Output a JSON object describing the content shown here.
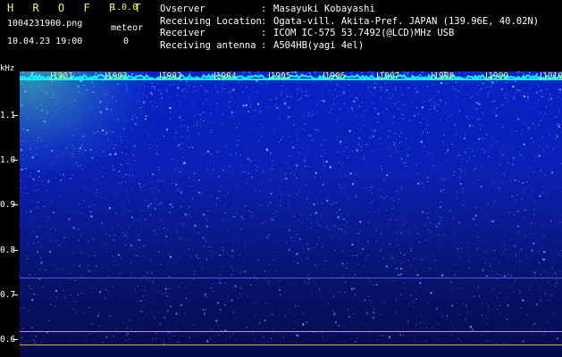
{
  "app": {
    "name": "H R O F F T",
    "version": "1.0.0"
  },
  "file": {
    "name": "1004231900.png",
    "datetime": "10.04.23 19:00"
  },
  "meteor": {
    "label": "meteor",
    "count": "0"
  },
  "info": [
    {
      "key": "Ovserver",
      "sep": ":",
      "value": "Masayuki Kobayashi"
    },
    {
      "key": "Receiving Location",
      "sep": ":",
      "value": "Ogata-vill. Akita-Pref. JAPAN (139.96E, 40.02N)"
    },
    {
      "key": "Receiver",
      "sep": ":",
      "value": "ICOM IC-575 53.7492(@LCD)MHz USB"
    },
    {
      "key": "Receiving antenna",
      "sep": ":",
      "value": "A504HB(yagi 4el)"
    }
  ],
  "chart_data": {
    "type": "heatmap",
    "y_unit": "kHz",
    "y_ticks": [
      "1.1",
      "1.0",
      "0.9",
      "0.8",
      "0.7",
      "0.6"
    ],
    "x_ticks": [
      "1901",
      "1902",
      "1903",
      "1904",
      "1905",
      "1906",
      "1907",
      "1908",
      "1909",
      "1910"
    ],
    "colors": {
      "background": "#000000",
      "spectrum_high": "#0a22c8",
      "spectrum_low": "#050c4a",
      "hot": "#5ae6a0",
      "accent_text": "#f2f25a"
    }
  }
}
